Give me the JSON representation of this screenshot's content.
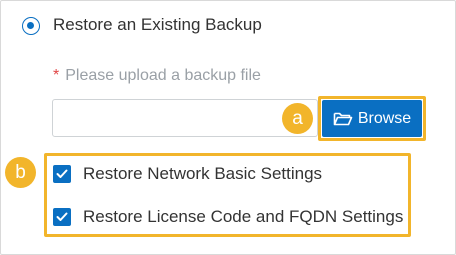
{
  "restore_option": {
    "label": "Restore an Existing Backup",
    "selected": true
  },
  "upload": {
    "required_mark": "*",
    "label": "Please upload a backup file",
    "file_value": "",
    "browse_label": "Browse",
    "browse_icon": "folder-open-icon"
  },
  "annotations": {
    "a": "a",
    "b": "b",
    "highlight_color": "#f2b52b"
  },
  "options": [
    {
      "label": "Restore Network Basic Settings",
      "checked": true
    },
    {
      "label": "Restore License Code and FQDN Settings",
      "checked": true
    }
  ],
  "colors": {
    "accent": "#0a6fc2",
    "text": "#333333",
    "placeholder": "#9aa0a6",
    "required": "#e04545"
  }
}
